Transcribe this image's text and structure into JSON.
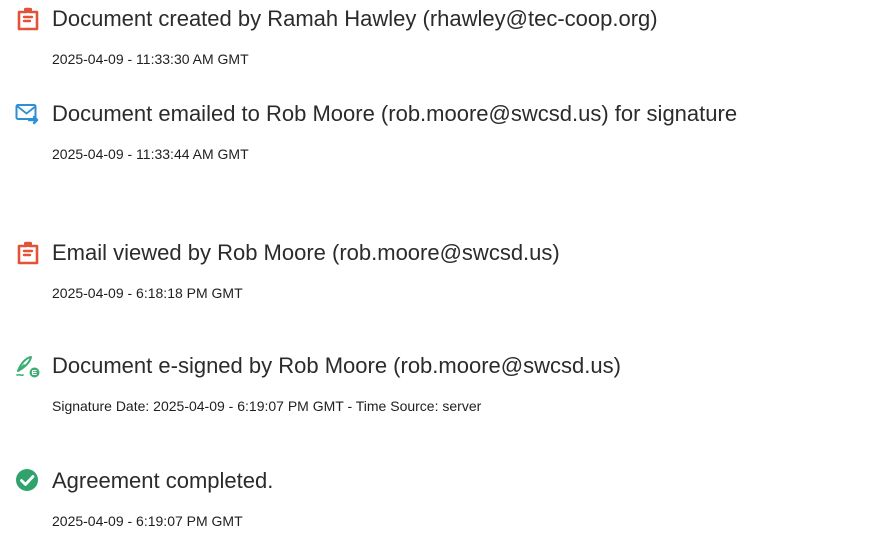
{
  "events": [
    {
      "icon": "document-created-icon",
      "title": "Document created by Ramah Hawley (rhawley@tec-coop.org)",
      "detail": "2025-04-09 - 11:33:30 AM GMT"
    },
    {
      "icon": "email-sent-icon",
      "title": "Document emailed to Rob Moore (rob.moore@swcsd.us) for signature",
      "detail": "2025-04-09 - 11:33:44 AM GMT"
    },
    {
      "icon": "email-viewed-icon",
      "title": "Email viewed by Rob Moore (rob.moore@swcsd.us)",
      "detail": "2025-04-09 - 6:18:18 PM GMT"
    },
    {
      "icon": "e-sign-pen-icon",
      "title": "Document e-signed by Rob Moore (rob.moore@swcsd.us)",
      "detail": "Signature Date: 2025-04-09 - 6:19:07 PM GMT - Time Source: server"
    },
    {
      "icon": "checkmark-circle-icon",
      "title": "Agreement completed.",
      "detail": "2025-04-09 - 6:19:07 PM GMT"
    }
  ],
  "colors": {
    "acrobat_red": "#e2533a",
    "email_blue": "#2d8fd5",
    "sign_green": "#3cae74",
    "complete_green": "#2fa36b"
  }
}
